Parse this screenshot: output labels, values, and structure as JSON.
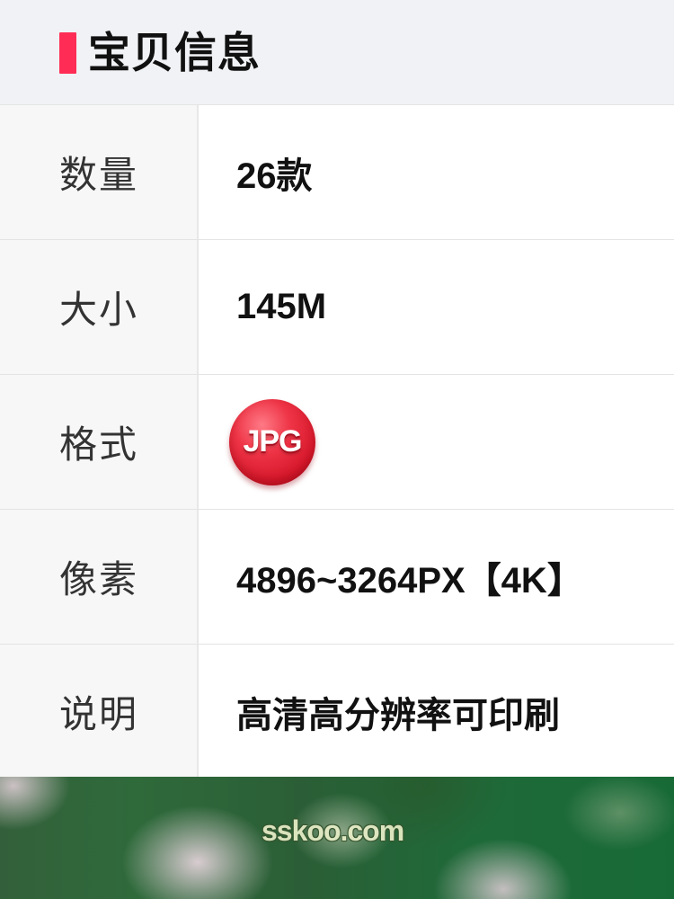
{
  "header": {
    "title": "宝贝信息",
    "accent_color": "#ff2d55"
  },
  "info_table": {
    "rows": [
      {
        "label": "数量",
        "value": "26款"
      },
      {
        "label": "大小",
        "value": "145M"
      },
      {
        "label": "格式",
        "value": "JPG",
        "value_type": "badge",
        "badge_color": "#e52237"
      },
      {
        "label": "像素",
        "value": "4896~3264PX【4K】"
      },
      {
        "label": "说明",
        "value": "高清高分辨率可印刷"
      }
    ]
  },
  "photo": {
    "watermark": "sskoo.com"
  }
}
